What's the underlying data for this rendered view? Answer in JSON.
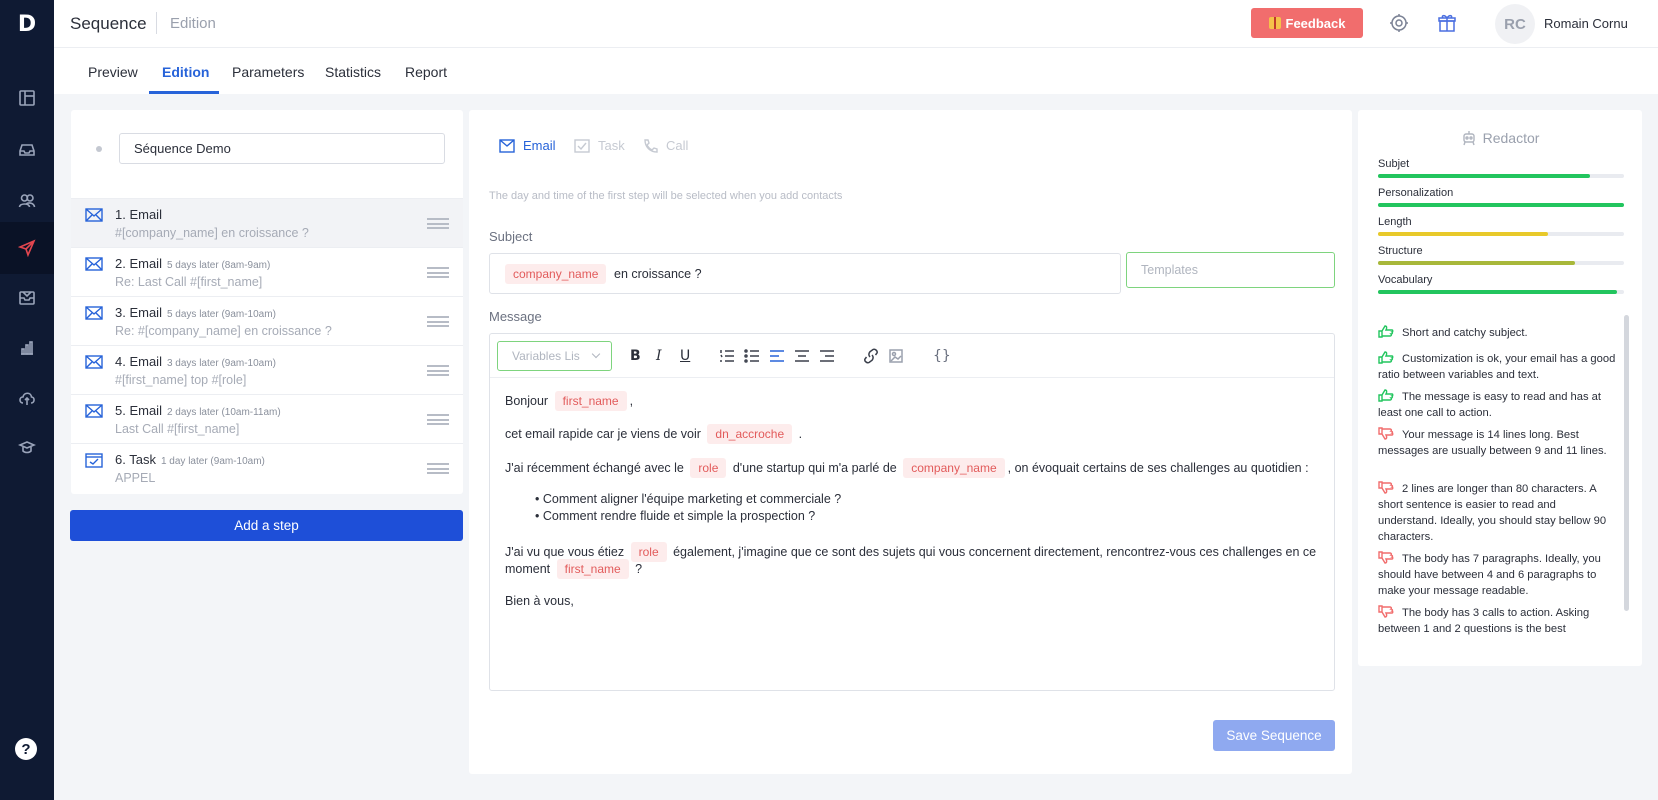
{
  "app": {
    "logo": "D"
  },
  "header": {
    "crumb_main": "Sequence",
    "crumb_sub": "Edition",
    "feedback_label": "Feedback",
    "avatar_initials": "RC",
    "user_name": "Romain Cornu"
  },
  "tabs": [
    {
      "label": "Preview"
    },
    {
      "label": "Edition",
      "active": true
    },
    {
      "label": "Parameters"
    },
    {
      "label": "Statistics"
    },
    {
      "label": "Report"
    }
  ],
  "sequence": {
    "name": "Séquence Demo",
    "add_step_label": "Add a step",
    "steps": [
      {
        "title": "1. Email",
        "delay": "",
        "subtitle": "#[company_name] en croissance ?",
        "type": "email",
        "selected": true
      },
      {
        "title": "2. Email",
        "delay": "5 days later (8am-9am)",
        "subtitle": "Re: Last Call #[first_name]",
        "type": "email"
      },
      {
        "title": "3. Email",
        "delay": "5 days later (9am-10am)",
        "subtitle": "Re: #[company_name] en croissance ?",
        "type": "email"
      },
      {
        "title": "4. Email",
        "delay": "3 days later (9am-10am)",
        "subtitle": "#[first_name] top #[role]",
        "type": "email"
      },
      {
        "title": "5. Email",
        "delay": "2 days later (10am-11am)",
        "subtitle": "Last Call #[first_name]",
        "type": "email"
      },
      {
        "title": "6. Task",
        "delay": "1 day later (9am-10am)",
        "subtitle": "APPEL",
        "type": "task"
      }
    ]
  },
  "editor": {
    "types": [
      {
        "label": "Email",
        "active": true
      },
      {
        "label": "Task"
      },
      {
        "label": "Call"
      }
    ],
    "hint": "The day and time of the first step will be selected when you add contacts",
    "subject_label": "Subject",
    "subject_var": "company_name",
    "subject_rest": "en croissance ?",
    "templates_placeholder": "Templates",
    "message_label": "Message",
    "variables_placeholder": "Variables Lis",
    "toolbar": {
      "bold": "B",
      "italic": "I",
      "underline": "U",
      "code": "{}"
    },
    "message": {
      "l1_text": "Bonjour",
      "l1_var": "first_name",
      "l1_end": ",",
      "l2_text": "cet email rapide car je viens de voir",
      "l2_var": "dn_accroche",
      "l2_end": ".",
      "l3_a": "J'ai récemment échangé avec le",
      "l3_var1": "role",
      "l3_b": "d'une startup qui m'a parlé de",
      "l3_var2": "company_name",
      "l3_c": ", on évoquait certains de ses challenges au quotidien :",
      "b1": "• Comment aligner l'équipe marketing et commerciale ?",
      "b2": "• Comment rendre fluide et simple la prospection ?",
      "l4_a": "J'ai vu que vous étiez",
      "l4_var": "role",
      "l4_b": "également, j'imagine que ce sont des sujets qui vous concernent directement, rencontrez-vous ces challenges en ce",
      "l5_a": "moment",
      "l5_var": "first_name",
      "l5_b": "?",
      "l6": "Bien à vous,"
    },
    "save_label": "Save Sequence"
  },
  "redactor": {
    "title": "Redactor",
    "metrics": [
      {
        "label": "Subjet",
        "value": 0.86,
        "color": "#22c55e"
      },
      {
        "label": "Personalization",
        "value": 1.0,
        "color": "#22c55e"
      },
      {
        "label": "Length",
        "value": 0.69,
        "color": "#e8c92a"
      },
      {
        "label": "Structure",
        "value": 0.8,
        "color": "#a8b83a"
      },
      {
        "label": "Vocabulary",
        "value": 0.97,
        "color": "#22c55e"
      }
    ],
    "feedback": [
      {
        "kind": "good",
        "text": "Short and catchy subject."
      },
      {
        "kind": "good",
        "text": "Customization is ok, your email has a good ratio between variables and text."
      },
      {
        "kind": "good",
        "text": "The message is easy to read and has at least one call to action."
      },
      {
        "kind": "bad",
        "text": "Your message is 14 lines long. Best messages are usually between 9 and 11 lines."
      },
      {
        "kind": "bad",
        "text": "2 lines are longer than 80 characters. A short sentence is easier to read and understand. Ideally, you should stay bellow 90 characters."
      },
      {
        "kind": "bad",
        "text": "The body has 7 paragraphs. Ideally, you should have between 4 and 6 paragraphs to make your message readable."
      },
      {
        "kind": "bad",
        "text": "The body has 3 calls to action. Asking between 1 and 2 questions is the best"
      }
    ]
  },
  "colors": {
    "accent": "#2763d9",
    "danger": "#e3464f",
    "sidebar": "#0f1a33",
    "good": "#22c55e",
    "bad": "#f16d6d"
  }
}
